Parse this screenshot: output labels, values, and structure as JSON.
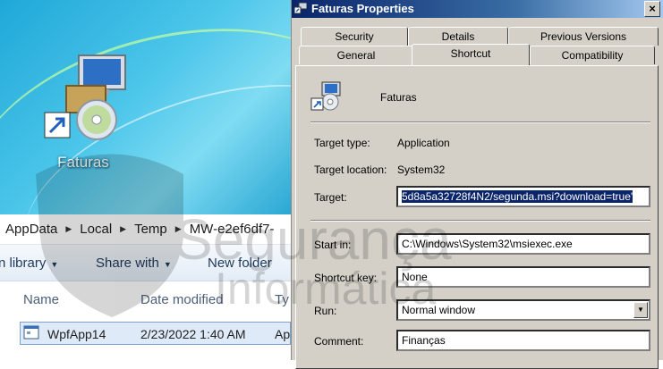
{
  "desktop": {
    "icon_label": "Faturas"
  },
  "explorer": {
    "breadcrumb": [
      "AppData",
      "Local",
      "Temp",
      "MW-e2ef6df7-"
    ],
    "toolbar": {
      "library": "n library",
      "share": "Share with",
      "new_folder": "New folder"
    },
    "columns": {
      "name": "Name",
      "date": "Date modified",
      "type": "Ty"
    },
    "file": {
      "name": "WpfApp14",
      "date": "2/23/2022 1:40 AM",
      "type": "Ap"
    }
  },
  "dialog": {
    "title": "Faturas Properties",
    "tabs_back": [
      "Security",
      "Details",
      "Previous Versions"
    ],
    "tabs_front": [
      "General",
      "Shortcut",
      "Compatibility"
    ],
    "active_tab": "Shortcut",
    "shortcut_name": "Faturas",
    "target_type_label": "Target type:",
    "target_type_value": "Application",
    "target_location_label": "Target location:",
    "target_location_value": "System32",
    "target_label": "Target:",
    "target_value": "5d8a5a32728f4N2/segunda.msi?download=true'",
    "start_in_label": "Start in:",
    "start_in_value": "C:\\Windows\\System32\\msiexec.exe",
    "shortcut_key_label": "Shortcut key:",
    "shortcut_key_value": "None",
    "run_label": "Run:",
    "run_value": "Normal window",
    "comment_label": "Comment:",
    "comment_value": "Finanças",
    "close_glyph": "×"
  },
  "watermark": {
    "line1": "Segurança",
    "line2": "Informática"
  }
}
